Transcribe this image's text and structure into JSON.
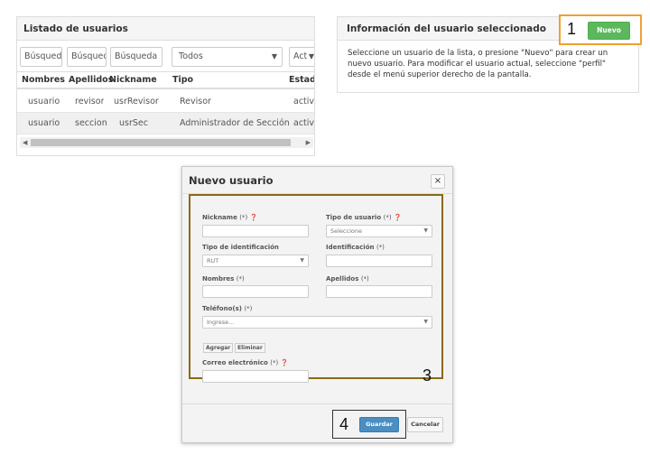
{
  "users_panel": {
    "title": "Listado de usuarios",
    "filters": [
      "Búsqued:",
      "Búsqued",
      "Búsqueda",
      "Todos",
      "Act"
    ],
    "columns": [
      "Nombres",
      "Apellidos",
      "Nickname",
      "Tipo",
      "Estad"
    ],
    "rows": [
      [
        "usuario",
        "revisor",
        "usrRevisor",
        "Revisor",
        "activ"
      ],
      [
        "usuario",
        "seccion",
        "usrSec",
        "Administrador de Sección",
        "activ"
      ]
    ]
  },
  "info_panel": {
    "title": "Información del usuario seleccionado",
    "new_button": "Nuevo",
    "text": "Seleccione un usuario de la lista, o presione \"Nuevo\" para crear un nuevo usuario. Para modificar el usuario actual, seleccione \"perfil\" desde el menú superior derecho de la pantalla."
  },
  "annotations": {
    "one": "1",
    "three": "3",
    "four": "4"
  },
  "modal": {
    "title": "Nuevo usuario",
    "close": "×",
    "nickname_label": "Nickname",
    "req": "(*)",
    "user_type_label": "Tipo de usuario",
    "user_type_value": "Seleccione",
    "id_type_label": "Tipo de identificación",
    "id_type_value": "RUT",
    "id_label": "Identificación",
    "names_label": "Nombres",
    "lastnames_label": "Apellidos",
    "phones_label": "Teléfono(s)",
    "phones_placeholder": "Ingrese...",
    "add_button": "Agregar",
    "remove_button": "Eliminar",
    "email_label": "Correo electrónico",
    "save_button": "Guardar",
    "cancel_button": "Cancelar"
  },
  "colors": {
    "green": "#5cb85c",
    "orange": "#f0a030",
    "olive": "#8b6914",
    "blue": "#4a8ec2"
  }
}
